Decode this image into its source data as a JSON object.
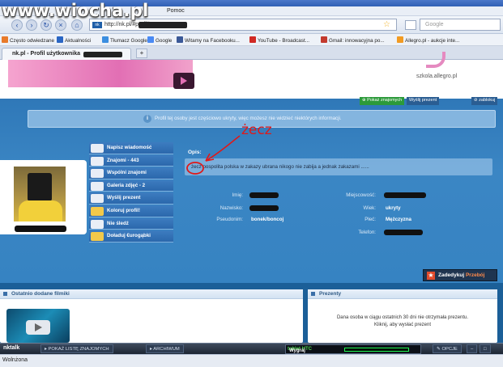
{
  "watermark": "www.wiocha.pl",
  "browser": {
    "menu": [
      "Pomoc"
    ],
    "url": "http://nk.pl/#profil/",
    "search_placeholder": "Google",
    "bookmarks": [
      "Często odwiedzane",
      "Aktualności",
      "Tłumacz Google",
      "Google",
      "Witamy na Facebooku...",
      "YouTube - Broadcast...",
      "Gmail: innowacyjna po...",
      "Allegro.pl - aukcje inte..."
    ],
    "tab_title": "nk.pl - Profil użytkownika",
    "status": "Wolnżona"
  },
  "banner": {
    "link": "szkola.allegro.pl"
  },
  "userbar": [
    "Pokaż znajomych",
    "Wyślij prezent",
    "zablokuj"
  ],
  "notice": "Profil tej osoby jest częściowo ukryty, więc możesz nie widzieć niektórych informacji.",
  "menu": [
    {
      "label": "Napisz wiadomość",
      "icon": "envelope-icon"
    },
    {
      "label": "Znajomi - 443",
      "icon": "friends-icon"
    },
    {
      "label": "Wspólni znajomi",
      "icon": "mutual-friends-icon"
    },
    {
      "label": "Galeria zdjęć - 2",
      "icon": "gallery-icon"
    },
    {
      "label": "Wyślij prezent",
      "icon": "gift-icon"
    },
    {
      "label": "Koloruj profil!",
      "icon": "palette-icon"
    },
    {
      "label": "Nie śledź",
      "icon": "unfollow-icon"
    },
    {
      "label": "Doładuj €urogąbki",
      "icon": "coins-icon"
    }
  ],
  "profile": {
    "opis_label": "Opis:",
    "opis_text": "żecz pospolita polska w zakazy ubrana nikogo nie zabija a jednak zakazami ......",
    "fields_left": [
      {
        "label": "Imię:",
        "value": ""
      },
      {
        "label": "Nazwisko:",
        "value": ""
      },
      {
        "label": "Pseudonim:",
        "value": "bonek/boncoj"
      }
    ],
    "fields_right": [
      {
        "label": "Miejscowość:",
        "value": ""
      },
      {
        "label": "Wiek:",
        "value": "ukryty"
      },
      {
        "label": "Płeć:",
        "value": "Mężczyzna"
      },
      {
        "label": "Telefon:",
        "value": ""
      }
    ]
  },
  "annotation": "żecz",
  "support": {
    "prefix": "Zadedykuj",
    "highlight": "Przebój"
  },
  "videos": {
    "title": "Ostatnio dodane filmiki"
  },
  "gifts": {
    "title": "Prezenty",
    "line1": "Dana osoba w ciągu ostatnich 30 dni nie otrzymała prezentu.",
    "line2": "Kliknij, aby wysłać prezent"
  },
  "nktalk": {
    "logo": "nktalk",
    "show_friends": "POKAŻ LISTĘ ZNAJOMYCH",
    "archive": "ARCHIWUM",
    "promo_prefix": "Wygraj",
    "promo_highlight": "tablet HTC",
    "options": "OPCJE"
  }
}
